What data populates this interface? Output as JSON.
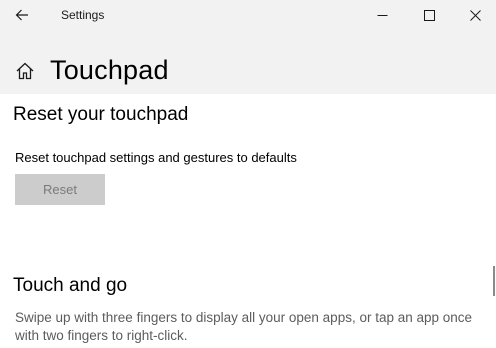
{
  "window": {
    "title": "Settings"
  },
  "icons": {
    "back": "arrow-left-icon",
    "home": "home-icon",
    "minimize": "minimize-icon",
    "maximize": "maximize-icon",
    "close": "close-icon"
  },
  "page": {
    "title": "Touchpad"
  },
  "reset_section": {
    "heading": "Reset your touchpad",
    "description": "Reset touchpad settings and gestures to defaults",
    "button_label": "Reset",
    "button_enabled": false
  },
  "touch_and_go": {
    "heading": "Touch and go",
    "text": "Swipe up with three fingers to display all your open apps, or tap an app once with two fingers to right-click."
  },
  "colors": {
    "titlebar_bg": "#f2f2f2",
    "content_bg": "#ffffff",
    "disabled_button_bg": "#cccccc",
    "disabled_button_text": "#7a7a7a",
    "secondary_text": "#5c5c5c"
  }
}
